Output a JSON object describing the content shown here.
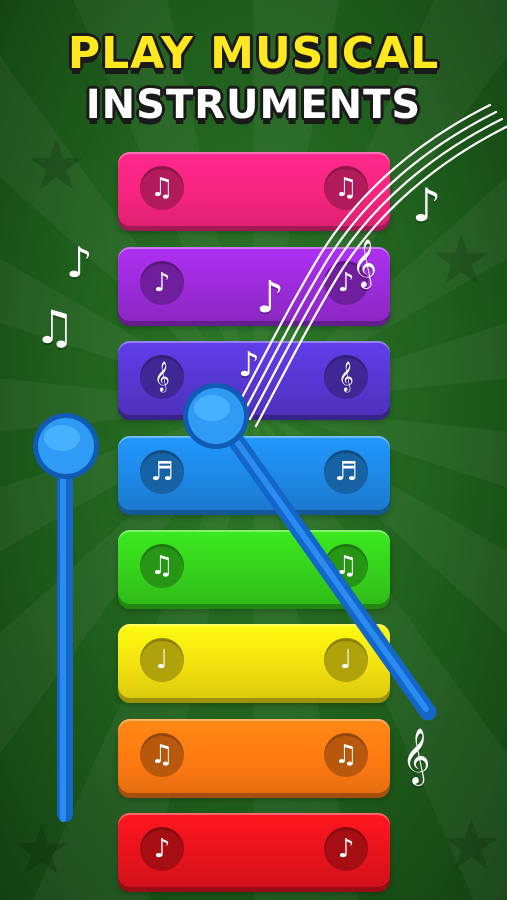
{
  "title": {
    "line1": "PLAY MUSICAL",
    "line2": "INSTRUMENTS"
  },
  "colors": {
    "title_yellow": "#ffe81f",
    "mallet_blue": "#1e88e5",
    "background_green": "#1f5e1c"
  },
  "keys": [
    {
      "name": "pink",
      "color": "#f7257f",
      "note": "♫",
      "icon": "beamed-eighth-notes-icon"
    },
    {
      "name": "purple",
      "color": "#9b2bd9",
      "note": "♪",
      "icon": "eighth-note-icon"
    },
    {
      "name": "indigo",
      "color": "#5637d1",
      "note": "𝄞",
      "icon": "treble-clef-icon"
    },
    {
      "name": "blue",
      "color": "#1e88e5",
      "note": "♬",
      "icon": "beamed-sixteenth-notes-icon"
    },
    {
      "name": "green",
      "color": "#36d11c",
      "note": "♫",
      "icon": "beamed-notes-icon"
    },
    {
      "name": "yellow",
      "color": "#f3e10f",
      "note": "♩",
      "icon": "quarter-note-icon"
    },
    {
      "name": "orange",
      "color": "#ff7a12",
      "note": "♫",
      "icon": "beamed-eighth-notes-icon"
    },
    {
      "name": "red",
      "color": "#e8141c",
      "note": "♪",
      "icon": "note-icon"
    }
  ],
  "decorations": {
    "note_a": "♪",
    "note_b": "♫",
    "clef": "𝄞"
  }
}
